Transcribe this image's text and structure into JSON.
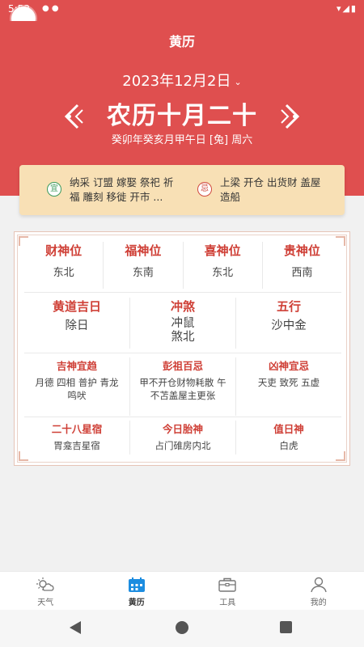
{
  "status": {
    "time": "5:53"
  },
  "app": {
    "title": "黄历"
  },
  "date": {
    "solar": "2023年12月2日",
    "lunar": "农历十月二十",
    "ganzhi": "癸卯年癸亥月甲午日 [兔] 周六"
  },
  "yiji": {
    "yi_seal": "宜",
    "yi_text": "纳采 订盟 嫁娶 祭祀 祈福 雕刻 移徙 开市 ...",
    "ji_seal": "忌",
    "ji_text": "上梁 开仓 出货财 盖屋 造船"
  },
  "gods": [
    {
      "label": "财神位",
      "value": "东北"
    },
    {
      "label": "福神位",
      "value": "东南"
    },
    {
      "label": "喜神位",
      "value": "东北"
    },
    {
      "label": "贵神位",
      "value": "西南"
    }
  ],
  "mid": [
    {
      "label": "黄道吉日",
      "value": "除日"
    },
    {
      "label": "冲煞",
      "value": "冲鼠\n煞北"
    },
    {
      "label": "五行",
      "value": "沙中金"
    }
  ],
  "bottom1": [
    {
      "label": "吉神宜趋",
      "value": "月德 四相 普护 青龙 鸣吠"
    },
    {
      "label": "彭祖百忌",
      "value": "甲不开仓财物耗散 午不苫盖屋主更张"
    },
    {
      "label": "凶神宜忌",
      "value": "天吏 致死 五虚"
    }
  ],
  "bottom2": [
    {
      "label": "二十八星宿",
      "value": "胃龛吉星宿"
    },
    {
      "label": "今日胎神",
      "value": "占门碓房内北"
    },
    {
      "label": "值日神",
      "value": "白虎"
    }
  ],
  "tabs": [
    {
      "label": "天气",
      "icon": "weather-icon"
    },
    {
      "label": "黄历",
      "icon": "calendar-icon"
    },
    {
      "label": "工具",
      "icon": "toolbox-icon"
    },
    {
      "label": "我的",
      "icon": "profile-icon"
    }
  ],
  "colors": {
    "header": "#df4f4f",
    "accent_red": "#cf3f36",
    "yiji_bg": "#f8e0b5",
    "active_tab": "#1d8de0"
  }
}
